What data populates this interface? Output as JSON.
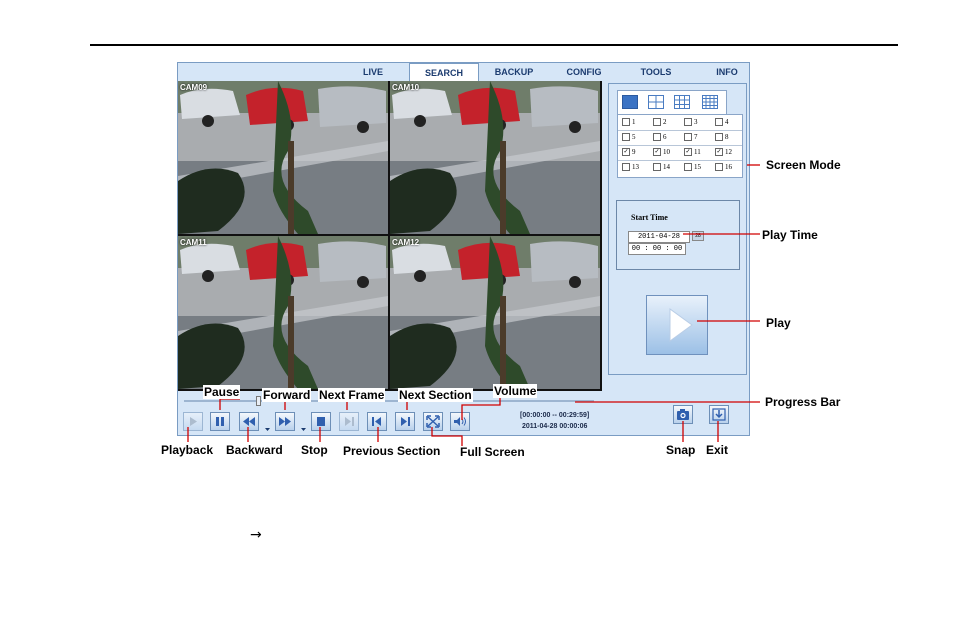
{
  "tabs": [
    "LIVE",
    "SEARCH",
    "BACKUP",
    "CONFIG",
    "TOOLS",
    "INFO"
  ],
  "active_tab": "SEARCH",
  "cameras": [
    {
      "label": "CAM09"
    },
    {
      "label": "CAM10"
    },
    {
      "label": "CAM11"
    },
    {
      "label": "CAM12"
    }
  ],
  "channels": [
    {
      "num": "1",
      "checked": false
    },
    {
      "num": "2",
      "checked": false
    },
    {
      "num": "3",
      "checked": false
    },
    {
      "num": "4",
      "checked": false
    },
    {
      "num": "5",
      "checked": false
    },
    {
      "num": "6",
      "checked": false
    },
    {
      "num": "7",
      "checked": false
    },
    {
      "num": "8",
      "checked": false
    },
    {
      "num": "9",
      "checked": true
    },
    {
      "num": "10",
      "checked": true
    },
    {
      "num": "11",
      "checked": true
    },
    {
      "num": "12",
      "checked": true
    },
    {
      "num": "13",
      "checked": false
    },
    {
      "num": "14",
      "checked": false
    },
    {
      "num": "15",
      "checked": false
    },
    {
      "num": "16",
      "checked": false
    }
  ],
  "play_time": {
    "title": "Start Time",
    "date": "2011-04-28",
    "time": "00 : 00 : 00",
    "calendar_label": "28"
  },
  "status": {
    "range": "[00:00:00 -- 00:29:59]",
    "datetime": "2011-04-28 00:00:06"
  },
  "annotations": {
    "screen_mode": "Screen Mode",
    "play_time": "Play Time",
    "play": "Play",
    "progress_bar": "Progress Bar",
    "pause": "Pause",
    "forward": "Forward",
    "next_frame": "Next Frame",
    "next_section": "Next Section",
    "volume": "Volume",
    "playback": "Playback",
    "backward": "Backward",
    "stop": "Stop",
    "previous_section": "Previous Section",
    "full_screen": "Full Screen",
    "snap": "Snap",
    "exit": "Exit"
  },
  "arrow_glyph": "→",
  "colors": {
    "window_bg": "#d6e6f7",
    "border": "#7a9cc3",
    "button_blue": "#2f5fae",
    "leader_red": "#d10000"
  }
}
